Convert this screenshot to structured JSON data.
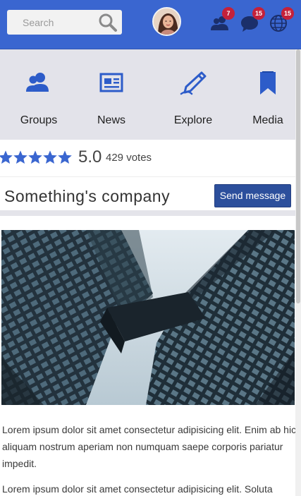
{
  "header": {
    "search_placeholder": "Search",
    "badges": {
      "friends": "7",
      "messages": "15",
      "notifications": "15"
    }
  },
  "nav": {
    "items": [
      {
        "label": "Groups",
        "icon": "groups-icon"
      },
      {
        "label": "News",
        "icon": "news-icon"
      },
      {
        "label": "Explore",
        "icon": "explore-icon"
      },
      {
        "label": "Media",
        "icon": "media-icon"
      }
    ]
  },
  "rating": {
    "stars": 5,
    "score": "5.0",
    "votes": "429 votes"
  },
  "company": {
    "name": "Something's company",
    "send_label": "Send message"
  },
  "content": {
    "paragraphs": [
      "Lorem ipsum dolor sit amet consectetur adipisicing elit. Enim ab hic aliquam nostrum aperiam non numquam saepe corporis pariatur impedit.",
      "Lorem ipsum dolor sit amet consectetur adipisicing elit. Soluta"
    ]
  },
  "colors": {
    "accent": "#3a66d0",
    "button": "#2c4f9c",
    "badge": "#c4213a",
    "star": "#3a66d0"
  }
}
